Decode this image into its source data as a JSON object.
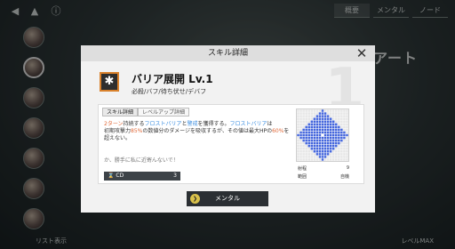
{
  "background": {
    "tabs": [
      "概要",
      "メンタル",
      "ノード"
    ],
    "character_name": "アート",
    "bottom_left": "リスト表示",
    "bottom_right": "レベルMAX"
  },
  "modal": {
    "title": "スキル詳細",
    "watermark": "1",
    "skill": {
      "name": "バリア展開 Lv.1",
      "tags": "必殺/バフ/待ち伏せ/デバフ"
    },
    "tabs": [
      {
        "label": "スキル詳細",
        "active": true
      },
      {
        "label": "レベルアップ詳細",
        "active": false
      }
    ],
    "description": {
      "p1": "2ターン",
      "p2": "持続する",
      "p3": "フロストバリア",
      "p4": "と",
      "p5": "警戒",
      "p6": "を獲得する。",
      "p7": "フロストバリア",
      "p8": "は",
      "p9": "初期攻撃力",
      "p10": "85%",
      "p11": "の数値分のダメージを吸収するが、その値は最大HPの",
      "p12": "60%",
      "p13": "を超えない。"
    },
    "quote": "か、勝手に私に近寄んないで！",
    "cd": {
      "label": "CD",
      "value": "3"
    },
    "range": {
      "distance_label": "射程",
      "distance_value": "9",
      "area_label": "範囲",
      "area_value": "自機"
    },
    "confirm_label": "メンタル"
  },
  "colors": {
    "accent": "#d9812c",
    "highlight_red": "#e06a3a",
    "highlight_blue": "#3a8de0",
    "grid_fill": "#4466dd"
  }
}
